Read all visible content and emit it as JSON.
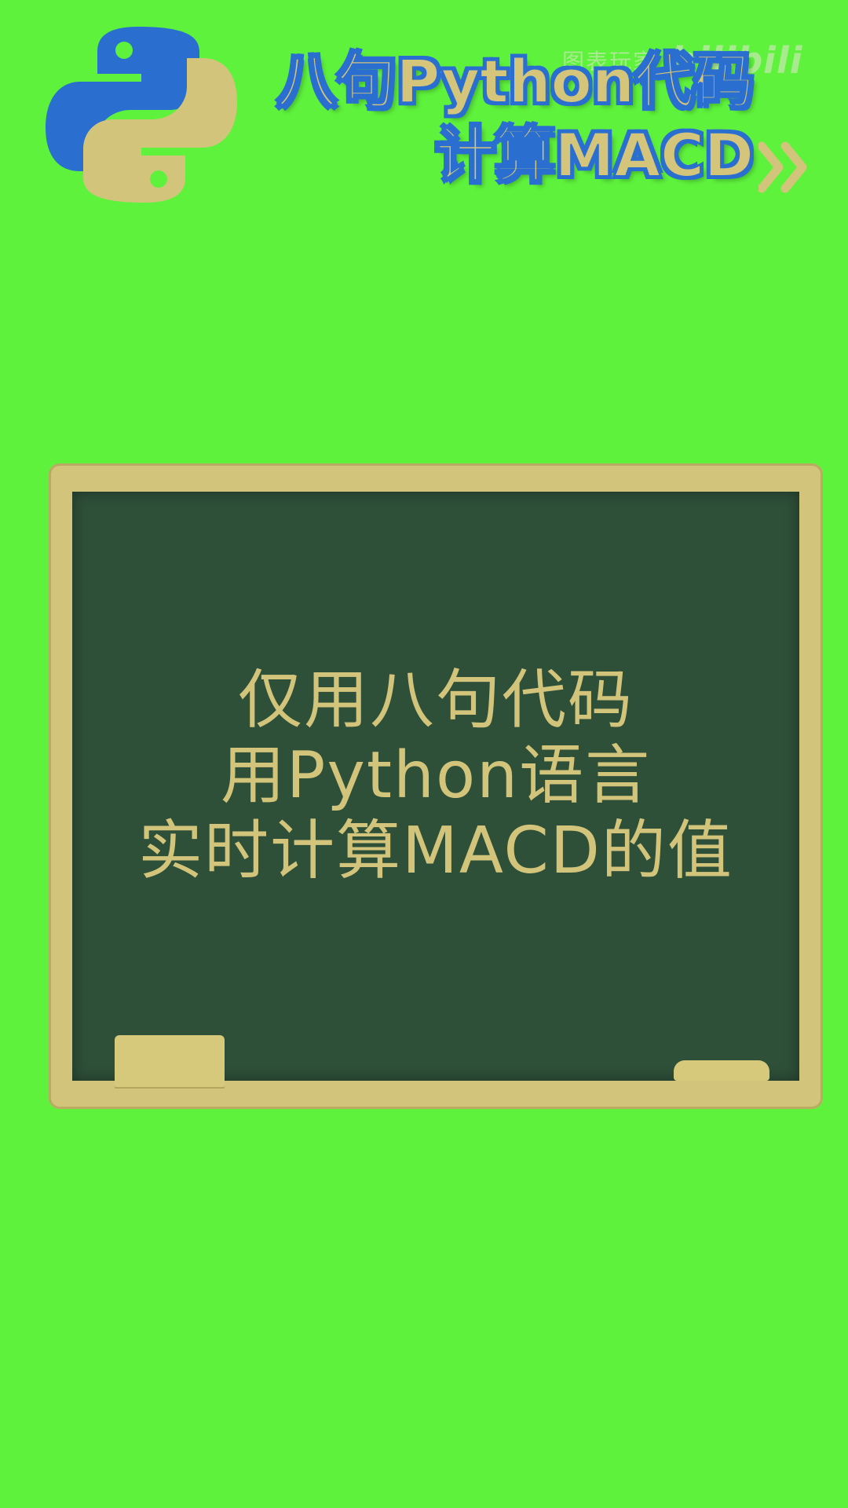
{
  "title": {
    "line1": "八句Python代码",
    "line2": "计算MACD"
  },
  "watermark": {
    "text": "图表玩家",
    "logo": "bilibili"
  },
  "board": {
    "lines": [
      "仅用八句代码",
      "用Python语言",
      "实时计算MACD的值"
    ]
  },
  "icons": {
    "logo": "python-logo-icon",
    "chevrons": "double-chevron-right-icon"
  },
  "colors": {
    "background": "#5ef23c",
    "board": "#2e4f38",
    "frame": "#d2c57b",
    "chalk_text": "#d2c57b",
    "title_fill": "#d4c57a",
    "title_outline": "#2a6fd0",
    "python_blue": "#2a6fd0",
    "python_yellow": "#d2c57b"
  }
}
